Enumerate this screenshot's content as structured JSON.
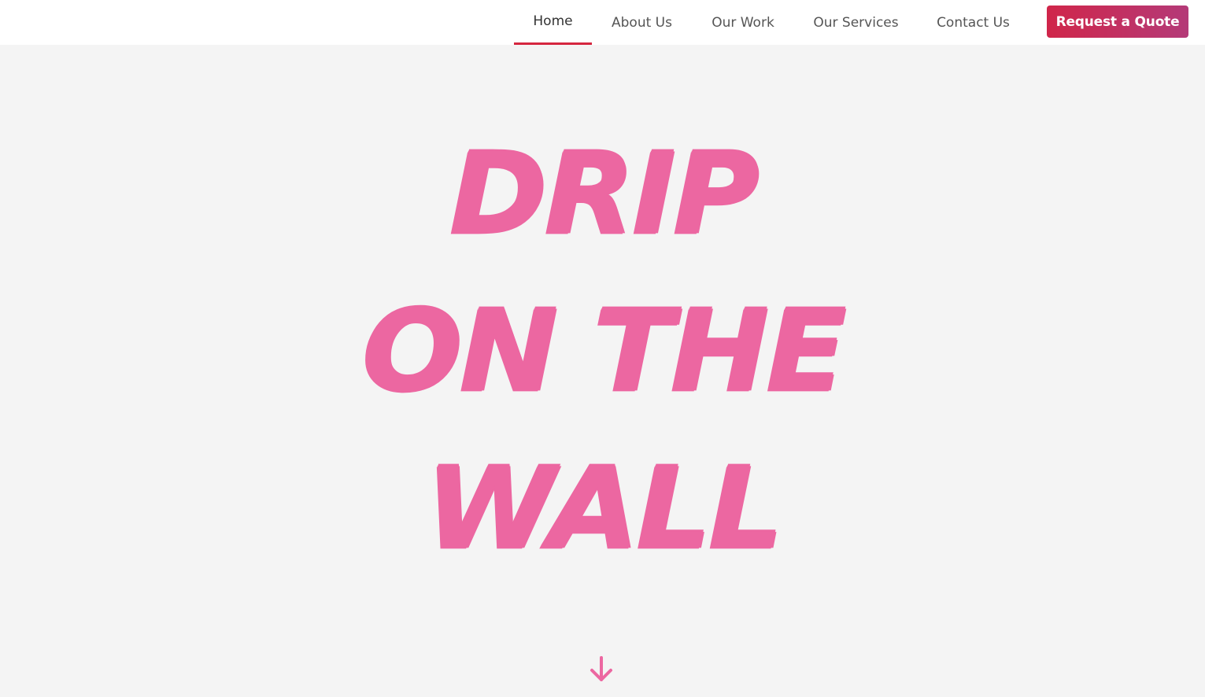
{
  "nav": {
    "items": [
      {
        "label": "Home",
        "active": true
      },
      {
        "label": "About Us",
        "active": false
      },
      {
        "label": "Our Work",
        "active": false
      },
      {
        "label": "Our Services",
        "active": false
      },
      {
        "label": "Contact Us",
        "active": false
      }
    ],
    "cta_label": "Request a Quote"
  },
  "hero": {
    "title_lines": [
      "Drip",
      "On the",
      "Wall"
    ],
    "scroll_icon": "arrow-down-icon"
  },
  "colors": {
    "accent_pink": "#ec67a1",
    "active_underline": "#d5263f",
    "cta_gradient_start": "#d0264a",
    "cta_gradient_end": "#b43a78",
    "hero_background": "#f4f4f4"
  }
}
